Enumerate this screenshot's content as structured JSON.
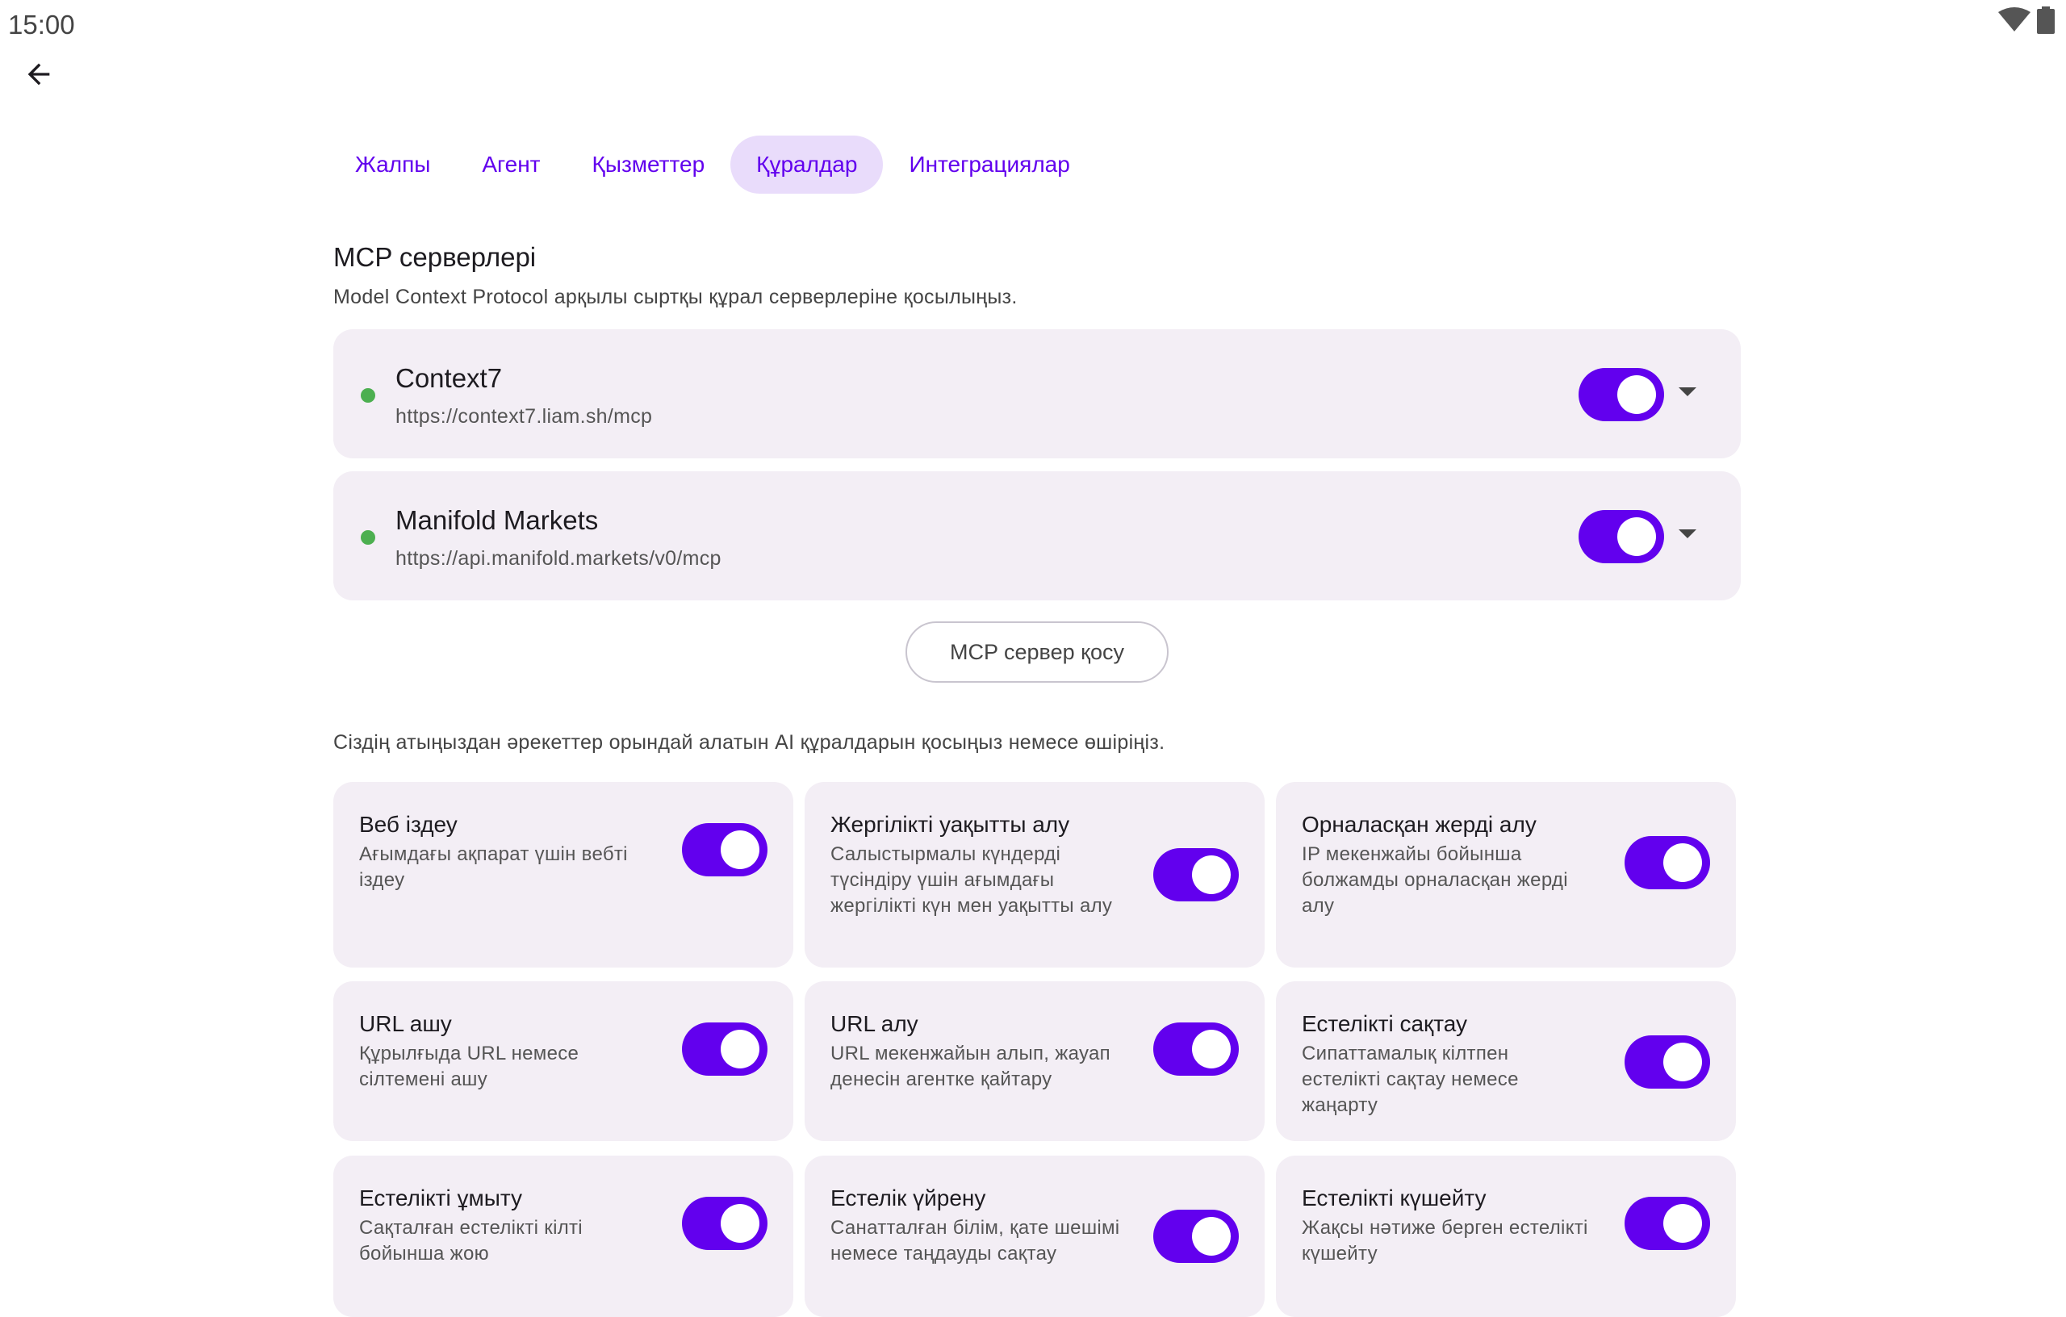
{
  "status_bar": {
    "time": "15:00",
    "wifi_icon": "wifi-icon",
    "battery_icon": "battery-icon"
  },
  "nav": {
    "back_icon": "arrow-left-icon"
  },
  "tabs": [
    {
      "label": "Жалпы",
      "active": false
    },
    {
      "label": "Агент",
      "active": false
    },
    {
      "label": "Қызметтер",
      "active": false
    },
    {
      "label": "Құралдар",
      "active": true
    },
    {
      "label": "Интеграциялар",
      "active": false
    }
  ],
  "mcp": {
    "title": "MCP серверлері",
    "description": "Model Context Protocol арқылы сыртқы құрал серверлеріне қосылыңыз.",
    "servers": [
      {
        "name": "Context7",
        "url": "https://context7.liam.sh/mcp",
        "enabled": true,
        "status_color": "#4caf50"
      },
      {
        "name": "Manifold Markets",
        "url": "https://api.manifold.markets/v0/mcp",
        "enabled": true,
        "status_color": "#4caf50"
      }
    ],
    "add_button": "MCP сервер қосу"
  },
  "tools": {
    "description": "Сіздің атыңыздан әрекеттер орындай алатын AI құралдарын қосыңыз немесе өшіріңіз.",
    "items": [
      {
        "title": "Веб іздеу",
        "desc": "Ағымдағы ақпарат үшін вебті іздеу",
        "enabled": true
      },
      {
        "title": "Жергілікті уақытты алу",
        "desc": "Салыстырмалы күндерді түсіндіру үшін ағымдағы жергілікті күн мен уақытты алу",
        "enabled": true
      },
      {
        "title": "Орналасқан жерді алу",
        "desc": "IP мекенжайы бойынша болжамды орналасқан жерді алу",
        "enabled": true
      },
      {
        "title": "URL ашу",
        "desc": "Құрылғыда URL немесе сілтемені ашу",
        "enabled": true
      },
      {
        "title": "URL алу",
        "desc": "URL мекенжайын алып, жауап денесін агентке қайтару",
        "enabled": true
      },
      {
        "title": "Естелікті сақтау",
        "desc": "Сипаттамалық кілтпен естелікті сақтау немесе жаңарту",
        "enabled": true
      },
      {
        "title": "Естелікті ұмыту",
        "desc": "Сақталған естелікті кілті бойынша жою",
        "enabled": true
      },
      {
        "title": "Естелік үйрену",
        "desc": "Санатталған білім, қате шешімі немесе таңдауды сақтау",
        "enabled": true
      },
      {
        "title": "Естелікті күшейту",
        "desc": "Жақсы нәтиже берген естелікті күшейту",
        "enabled": true
      }
    ]
  },
  "colors": {
    "accent": "#6200ee",
    "tab_active_bg": "#e9dcfb",
    "card_bg": "#f3eef5"
  }
}
